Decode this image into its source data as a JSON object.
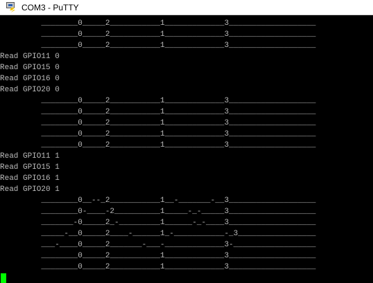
{
  "window": {
    "title": "COM3 - PuTTY",
    "app_icon": "putty-icon"
  },
  "terminal": {
    "colors": {
      "background": "#000000",
      "text": "#bbbbbb",
      "cursor": "#00ff00"
    },
    "lines": [
      {
        "type": "trace",
        "text": "         ________0_____2___________1_____________3___________________"
      },
      {
        "type": "trace",
        "text": "         ________0_____2___________1_____________3___________________"
      },
      {
        "type": "trace",
        "text": "         ________0_____2___________1_____________3___________________"
      },
      {
        "type": "text",
        "text": "Read GPIO11 0"
      },
      {
        "type": "text",
        "text": "Read GPIO15 0"
      },
      {
        "type": "text",
        "text": "Read GPIO16 0"
      },
      {
        "type": "text",
        "text": "Read GPIO20 0"
      },
      {
        "type": "trace",
        "text": "         ________0_____2___________1_____________3___________________"
      },
      {
        "type": "trace",
        "text": "         ________0_____2___________1_____________3___________________"
      },
      {
        "type": "trace",
        "text": "         ________0_____2___________1_____________3___________________"
      },
      {
        "type": "trace",
        "text": "         ________0_____2___________1_____________3___________________"
      },
      {
        "type": "trace",
        "text": "         ________0_____2___________1_____________3___________________"
      },
      {
        "type": "text",
        "text": "Read GPIO11 1"
      },
      {
        "type": "text",
        "text": "Read GPIO15 1"
      },
      {
        "type": "text",
        "text": "Read GPIO16 1"
      },
      {
        "type": "text",
        "text": "Read GPIO20 1"
      },
      {
        "type": "trace",
        "text": "         ________0__--_2___________1__-_______-__3___________________"
      },
      {
        "type": "trace",
        "text": "         ________0-____-2__________1_____-_-_____3___________________"
      },
      {
        "type": "trace",
        "text": "         _______-0_____2_-_________1______-_-____3___________________"
      },
      {
        "type": "trace",
        "text": "         _____-__0_____2____-______1_-___________-_3_________________"
      },
      {
        "type": "trace",
        "text": "         ___-____0_____2_______-___-_____________3-__________________"
      },
      {
        "type": "trace",
        "text": "         ________0_____2___________1_____________3___________________"
      },
      {
        "type": "trace",
        "text": "         ________0_____2___________1_____________3___________________"
      }
    ]
  }
}
